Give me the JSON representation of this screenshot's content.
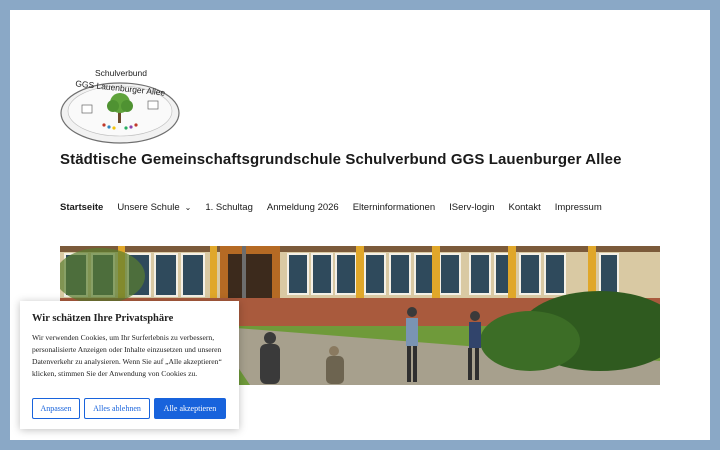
{
  "logo": {
    "top_text": "Schulverbund",
    "bottom_text": "GGS Lauenburger Allee",
    "icon": "school-tree-logo-icon"
  },
  "site_title": "Städtische Gemeinschaftsgrundschule Schulverbund GGS Lauenburger Allee",
  "nav": {
    "items": [
      {
        "label": "Startseite"
      },
      {
        "label": "Unsere Schule"
      },
      {
        "label": "1. Schultag"
      },
      {
        "label": "Anmeldung 2026"
      },
      {
        "label": "Elterninformationen"
      },
      {
        "label": "IServ-login"
      },
      {
        "label": "Kontakt"
      },
      {
        "label": "Impressum"
      }
    ],
    "dropdown_icon": "chevron-down-icon"
  },
  "hero": {
    "image": "school-building-photo"
  },
  "cookie": {
    "title": "Wir schätzen Ihre Privatsphäre",
    "text": "Wir verwenden Cookies, um Ihr Surferlebnis zu verbessern, personalisierte Anzeigen oder Inhalte einzusetzen und unseren Datenverkehr zu analysieren. Wenn Sie auf „Alle akzeptieren“ klicken, stimmen Sie der Anwendung von Cookies zu.",
    "buttons": {
      "customize": "Anpassen",
      "reject": "Alles ablehnen",
      "accept": "Alle akzeptieren"
    },
    "accent_color": "#1863dc"
  },
  "colors": {
    "frame": "#8aa8c6",
    "page": "#ffffff"
  }
}
